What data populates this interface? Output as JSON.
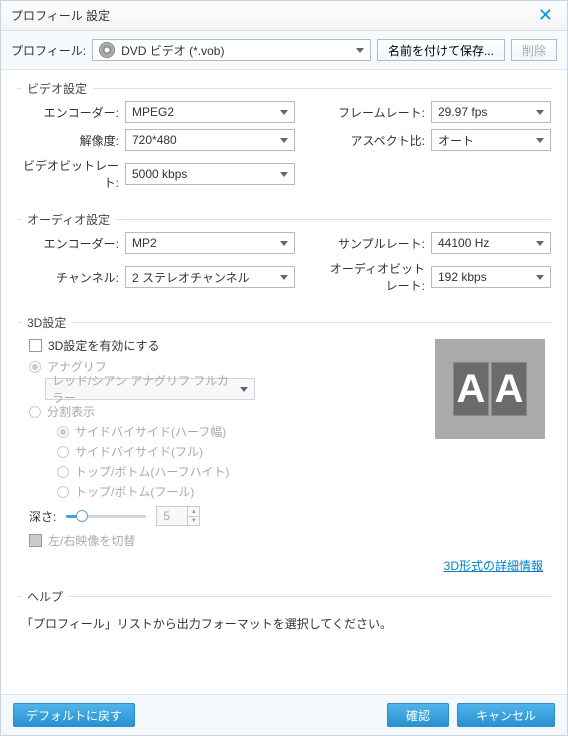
{
  "window": {
    "title": "プロフィール 設定"
  },
  "toolbar": {
    "profile_label": "プロフィール:",
    "profile_value": "DVD ビデオ (*.vob)",
    "save_as_label": "名前を付けて保存...",
    "delete_label": "削除"
  },
  "video": {
    "legend": "ビデオ設定",
    "encoder_label": "エンコーダー:",
    "encoder_value": "MPEG2",
    "resolution_label": "解像度:",
    "resolution_value": "720*480",
    "bitrate_label": "ビデオビットレート:",
    "bitrate_value": "5000 kbps",
    "framerate_label": "フレームレート:",
    "framerate_value": "29.97 fps",
    "aspect_label": "アスペクト比:",
    "aspect_value": "オート"
  },
  "audio": {
    "legend": "オーディオ設定",
    "encoder_label": "エンコーダー:",
    "encoder_value": "MP2",
    "channel_label": "チャンネル:",
    "channel_value": "2 ステレオチャンネル",
    "samplerate_label": "サンプルレート:",
    "samplerate_value": "44100 Hz",
    "audiobitrate_label": "オーディオビットレート:",
    "audiobitrate_value": "192 kbps"
  },
  "threed": {
    "legend": "3D設定",
    "enable_label": "3D設定を有効にする",
    "anaglyph_label": "アナグリフ",
    "anaglyph_select": "レッド/シアン アナグリフ フルカラー",
    "split_label": "分割表示",
    "sbs_half_label": "サイドバイサイド(ハーフ幅)",
    "sbs_full_label": "サイドバイサイド(フル)",
    "tb_half_label": "トップ/ボトム(ハーフハイト)",
    "tb_full_label": "トップ/ボトム(フール)",
    "depth_label": "深さ:",
    "depth_value": "5",
    "swap_label": "左/右映像を切替",
    "detail_link": "3D形式の詳細情報"
  },
  "help": {
    "legend": "ヘルプ",
    "text": "「プロフィール」リストから出力フォーマットを選択してください。"
  },
  "footer": {
    "default_label": "デフォルトに戻す",
    "ok_label": "確認",
    "cancel_label": "キャンセル"
  }
}
